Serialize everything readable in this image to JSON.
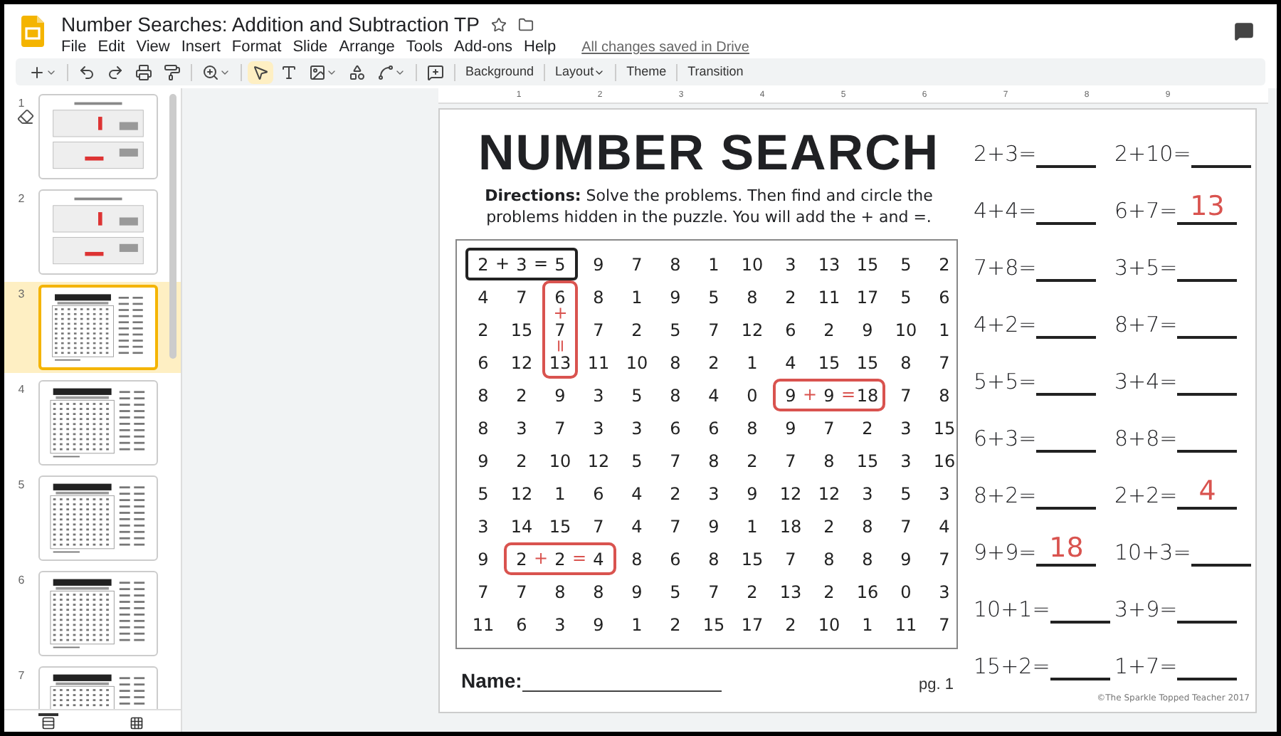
{
  "app": {
    "title": "Number Searches: Addition and Subtraction TP",
    "save_status": "All changes saved in Drive"
  },
  "menu": [
    "File",
    "Edit",
    "View",
    "Insert",
    "Format",
    "Slide",
    "Arrange",
    "Tools",
    "Add-ons",
    "Help"
  ],
  "toolbar": {
    "tools": [
      {
        "selected": false
      },
      {
        "selected": false
      },
      {
        "selected": false
      },
      {
        "selected": false
      },
      {
        "selected": false
      },
      {
        "selected": false
      },
      {
        "selected": true
      },
      {
        "selected": false
      },
      {
        "selected": false
      },
      {
        "selected": false
      },
      {
        "selected": false
      },
      {
        "selected": false
      }
    ],
    "buttons": [
      {
        "label": "Background",
        "dropdown": false
      },
      {
        "label": "Layout",
        "dropdown": true
      },
      {
        "label": "Theme",
        "dropdown": false
      },
      {
        "label": "Transition",
        "dropdown": false
      }
    ]
  },
  "slides_panel": {
    "thumbnails": [
      {
        "number": "1",
        "selected": false,
        "kind": "guide"
      },
      {
        "number": "2",
        "selected": false,
        "kind": "guide"
      },
      {
        "number": "3",
        "selected": true,
        "kind": "worksheet"
      },
      {
        "number": "4",
        "selected": false,
        "kind": "worksheet"
      },
      {
        "number": "5",
        "selected": false,
        "kind": "worksheet"
      },
      {
        "number": "6",
        "selected": false,
        "kind": "worksheet"
      },
      {
        "number": "7",
        "selected": false,
        "kind": "worksheet"
      }
    ],
    "views": [
      {
        "selected": true
      },
      {
        "selected": false
      }
    ]
  },
  "ruler": [
    "1",
    "2",
    "3",
    "4",
    "5",
    "6",
    "7",
    "8",
    "9"
  ],
  "slide": {
    "title": "NUMBER SEARCH",
    "directions": "**Directions:** Solve the problems. Then find and circle the problems hidden in the puzzle. You will add the + and =.",
    "grid": {
      "rows": [
        [
          {
            "text": "2",
            "kind": "printed-across",
            "sign": "+"
          },
          {
            "text": "3",
            "kind": "inside",
            "sign": "="
          },
          {
            "text": "5",
            "kind": "inside"
          },
          "9",
          "7",
          "8",
          "1",
          "10",
          "3",
          "13",
          "15",
          "5",
          "2"
        ],
        [
          "4",
          "7",
          {
            "text": "6",
            "kind": "handwritten-down",
            "sign": "+"
          },
          "8",
          "1",
          "9",
          "5",
          "8",
          "2",
          "11",
          "17",
          "5",
          "6"
        ],
        [
          "2",
          "15",
          {
            "text": "7",
            "kind": "inside",
            "sign": "="
          },
          "7",
          "2",
          "5",
          "7",
          "12",
          "6",
          "2",
          "9",
          "10",
          "1"
        ],
        [
          "6",
          "12",
          {
            "text": "13",
            "kind": "inside"
          },
          "11",
          "10",
          "8",
          "2",
          "1",
          "4",
          "15",
          "15",
          "8",
          "7"
        ],
        [
          "8",
          "2",
          "9",
          "3",
          "5",
          "8",
          "4",
          "0",
          {
            "text": "9",
            "kind": "handwritten-across",
            "sign": "+"
          },
          {
            "text": "9",
            "kind": "inside",
            "sign": "="
          },
          {
            "text": "18",
            "kind": "inside"
          },
          "7",
          "8"
        ],
        [
          "8",
          "3",
          "7",
          "3",
          "3",
          "6",
          "6",
          "8",
          "9",
          "7",
          "2",
          "3",
          "15"
        ],
        [
          "9",
          "2",
          "10",
          "12",
          "5",
          "7",
          "8",
          "2",
          "7",
          "8",
          "15",
          "3",
          "16"
        ],
        [
          "5",
          "12",
          "1",
          "6",
          "4",
          "2",
          "3",
          "9",
          "12",
          "12",
          "3",
          "5",
          "3"
        ],
        [
          "3",
          "14",
          "15",
          "7",
          "4",
          "7",
          "9",
          "1",
          "18",
          "2",
          "8",
          "7",
          "4"
        ],
        [
          "9",
          {
            "text": "2",
            "kind": "handwritten-across",
            "sign": "+"
          },
          {
            "text": "2",
            "kind": "inside",
            "sign": "="
          },
          {
            "text": "4",
            "kind": "inside"
          },
          "8",
          "6",
          "8",
          "15",
          "7",
          "8",
          "8",
          "9",
          "7"
        ],
        [
          "7",
          "7",
          "8",
          "8",
          "9",
          "5",
          "7",
          "2",
          "13",
          "2",
          "16",
          "0",
          "3"
        ],
        [
          "11",
          "6",
          "3",
          "9",
          "1",
          "2",
          "15",
          "17",
          "2",
          "10",
          "1",
          "11",
          "7"
        ]
      ]
    },
    "name_label": "Name:",
    "page": "pg. 1",
    "problems": [
      {
        "expr": "2+3="
      },
      {
        "expr": "2+10="
      },
      {
        "expr": "4+4="
      },
      {
        "expr": "6+7=",
        "answer": "13"
      },
      {
        "expr": "7+8="
      },
      {
        "expr": "3+5="
      },
      {
        "expr": "4+2="
      },
      {
        "expr": "8+7="
      },
      {
        "expr": "5+5="
      },
      {
        "expr": "3+4="
      },
      {
        "expr": "6+3="
      },
      {
        "expr": "8+8="
      },
      {
        "expr": "8+2="
      },
      {
        "expr": "2+2=",
        "answer": "4"
      },
      {
        "expr": "9+9=",
        "answer": "18"
      },
      {
        "expr": "10+3="
      },
      {
        "expr": "10+1="
      },
      {
        "expr": "3+9="
      },
      {
        "expr": "15+2="
      },
      {
        "expr": "1+7="
      }
    ],
    "credit": "©The Sparkle Topped Teacher 2017"
  }
}
